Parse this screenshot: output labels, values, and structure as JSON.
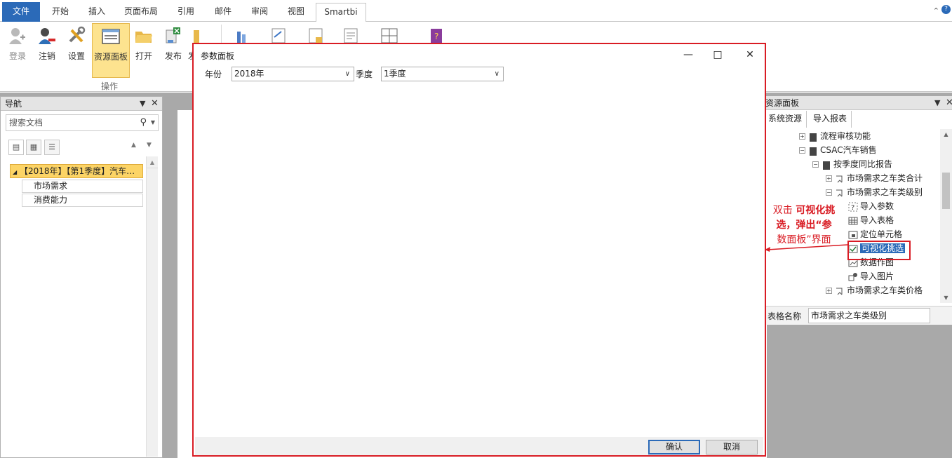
{
  "ribbon": {
    "tabs": [
      "文件",
      "开始",
      "插入",
      "页面布局",
      "引用",
      "邮件",
      "审阅",
      "视图",
      "Smartbi"
    ],
    "active_tab": "Smartbi",
    "buttons": {
      "login": "登录",
      "logout": "注销",
      "settings": "设置",
      "resource_panel": "资源面板",
      "open": "打开",
      "publish": "发布",
      "partial": "发"
    },
    "group_label": "操作"
  },
  "nav": {
    "title": "导航",
    "search_placeholder": "搜索文档",
    "root": "【2018年】【第1季度】汽车…",
    "children": [
      "市场需求",
      "消费能力"
    ]
  },
  "resource_panel": {
    "title": "资源面板",
    "tabs": [
      "系统资源",
      "导入报表"
    ],
    "tree": [
      {
        "label": "流程审核功能",
        "icon": "folder-icon"
      },
      {
        "label": "CSAC汽车销售",
        "icon": "folder-icon"
      },
      {
        "label": "按季度同比报告",
        "icon": "folder-icon"
      },
      {
        "label": "市场需求之车类合计",
        "icon": "report-icon"
      },
      {
        "label": "市场需求之车类级别",
        "icon": "report-icon"
      },
      {
        "label": "导入参数",
        "icon": "param-icon"
      },
      {
        "label": "导入表格",
        "icon": "table-icon"
      },
      {
        "label": "定位单元格",
        "icon": "cell-icon"
      },
      {
        "label": "可视化挑选",
        "icon": "visual-pick-icon"
      },
      {
        "label": "数据作图",
        "icon": "chart-icon"
      },
      {
        "label": "导入图片",
        "icon": "image-icon"
      },
      {
        "label": "市场需求之车类价格",
        "icon": "report-icon"
      }
    ],
    "name_label": "表格名称",
    "name_value": "市场需求之车类级别"
  },
  "callout": {
    "line1_normal": "双击",
    "line1_bold": "可视化挑",
    "line2": "选，弹出“参",
    "line3": "数面板”界面"
  },
  "dialog": {
    "title": "参数面板",
    "year_label": "年份",
    "year_value": "2018年",
    "quarter_label": "季度",
    "quarter_value": "1季度",
    "ok": "确认",
    "cancel": "取消"
  }
}
